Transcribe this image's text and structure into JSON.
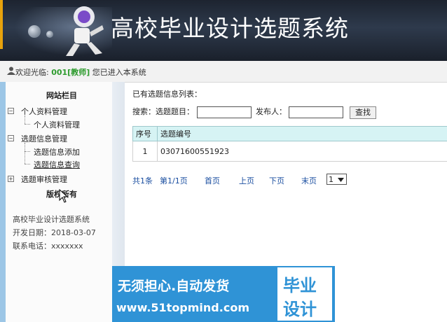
{
  "header": {
    "title": "高校毕业设计选题系统"
  },
  "welcome": {
    "prefix": "欢迎光临:",
    "user": "001[教师]",
    "suffix": "您已进入本系统"
  },
  "sidebar": {
    "heading": "网站栏目",
    "groups": [
      {
        "label": "个人资料管理",
        "children": [
          "个人资料管理"
        ]
      },
      {
        "label": "选题信息管理",
        "children": [
          "选题信息添加",
          "选题信息查询"
        ]
      },
      {
        "label": "选题审核管理",
        "children": []
      }
    ],
    "copyright": "版权所有",
    "info": {
      "system": "高校毕业设计选题系统",
      "date": "开发日期：2018-03-07",
      "phone": "联系电话：xxxxxxx"
    }
  },
  "main": {
    "list_title": "已有选题信息列表：",
    "search": {
      "label": "搜索：",
      "title_label": "选题题目：",
      "title_value": "",
      "publisher_label": "发布人：",
      "publisher_value": "",
      "button": "查找"
    },
    "table": {
      "columns": [
        "序号",
        "选题编号"
      ],
      "rows": [
        [
          "1",
          "03071600551923"
        ]
      ]
    },
    "pager": {
      "total": "共1条",
      "page": "第1/1页",
      "first": "首页",
      "prev": "上页",
      "next": "下页",
      "last": "末页",
      "selected": "1"
    }
  },
  "ad": {
    "line1": "无须担心.自动发货",
    "line2": "www.51topmind.com",
    "badge1": "毕业",
    "badge2": "设计"
  },
  "colors": {
    "accent": "#2f93d6",
    "table_header": "#d6f3f4",
    "highlight": "#2d9b2d"
  }
}
